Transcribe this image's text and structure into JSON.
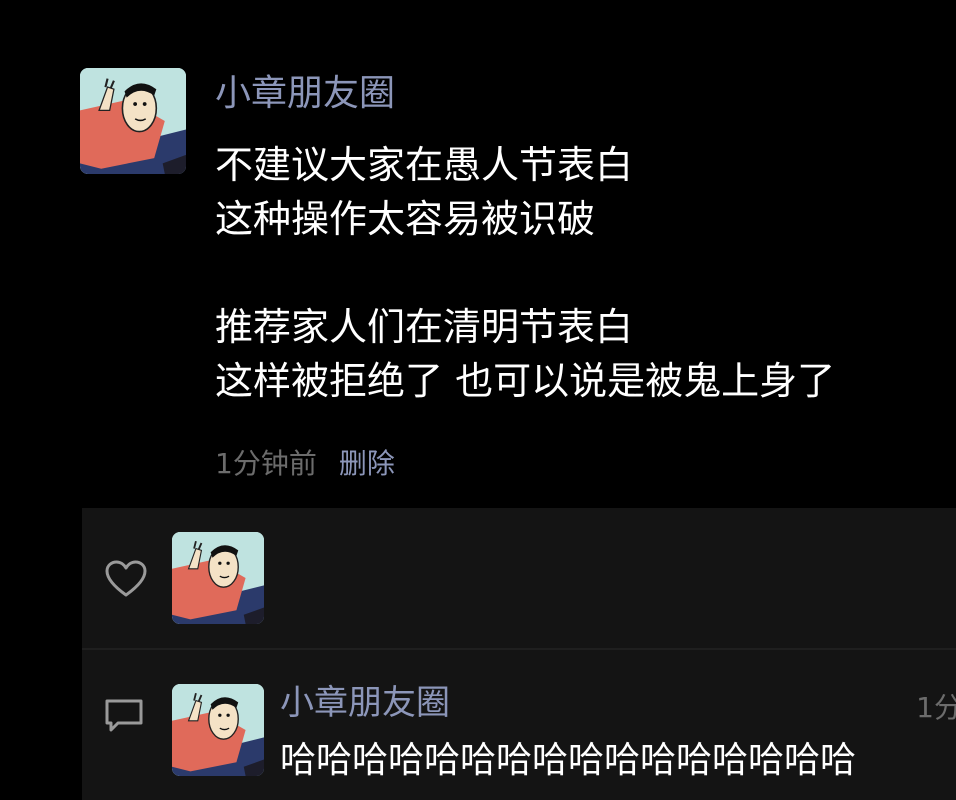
{
  "post": {
    "username": "小章朋友圈",
    "content_lines": [
      "不建议大家在愚人节表白",
      "这种操作太容易被识破",
      "",
      "推荐家人们在清明节表白",
      "这样被拒绝了 也可以说是被鬼上身了"
    ],
    "time": "1分钟前",
    "delete_label": "删除"
  },
  "likes": {
    "icon": "heart-outline-icon"
  },
  "comments": [
    {
      "icon": "speech-bubble-icon",
      "username": "小章朋友圈",
      "time": "1分",
      "text": "哈哈哈哈哈哈哈哈哈哈哈哈哈哈哈哈"
    }
  ],
  "colors": {
    "background": "#000000",
    "panel": "#141414",
    "username": "#8c96b9",
    "meta": "#6c6c6c",
    "text": "#ffffff"
  }
}
